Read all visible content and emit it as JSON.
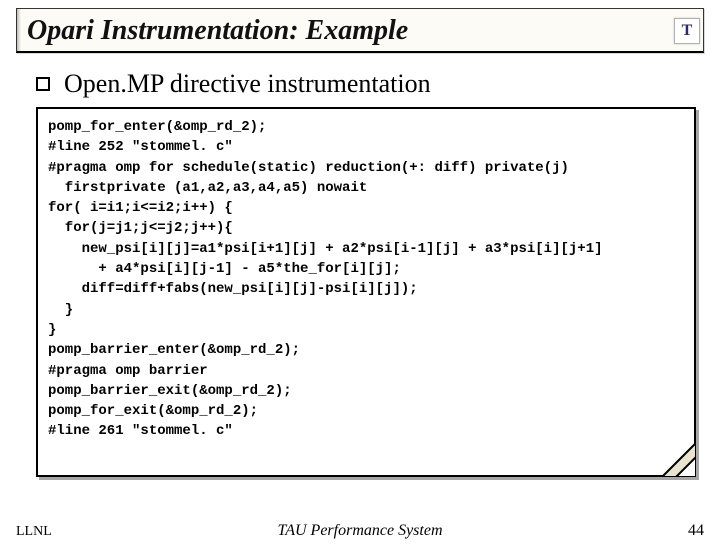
{
  "header": {
    "title": "Opari Instrumentation: Example",
    "logo_letter": "T"
  },
  "bullet": {
    "text": "Open.MP directive instrumentation"
  },
  "code": {
    "lines": [
      "pomp_for_enter(&omp_rd_2);",
      "#line 252 \"stommel. c\"",
      "#pragma omp for schedule(static) reduction(+: diff) private(j)",
      "  firstprivate (a1,a2,a3,a4,a5) nowait",
      "for( i=i1;i<=i2;i++) {",
      "  for(j=j1;j<=j2;j++){",
      "    new_psi[i][j]=a1*psi[i+1][j] + a2*psi[i-1][j] + a3*psi[i][j+1]",
      "      + a4*psi[i][j-1] - a5*the_for[i][j];",
      "    diff=diff+fabs(new_psi[i][j]-psi[i][j]);",
      "  }",
      "}",
      "pomp_barrier_enter(&omp_rd_2);",
      "#pragma omp barrier",
      "pomp_barrier_exit(&omp_rd_2);",
      "pomp_for_exit(&omp_rd_2);",
      "#line 261 \"stommel. c\""
    ]
  },
  "footer": {
    "left": "LLNL",
    "center": "TAU Performance System",
    "page": "44"
  }
}
